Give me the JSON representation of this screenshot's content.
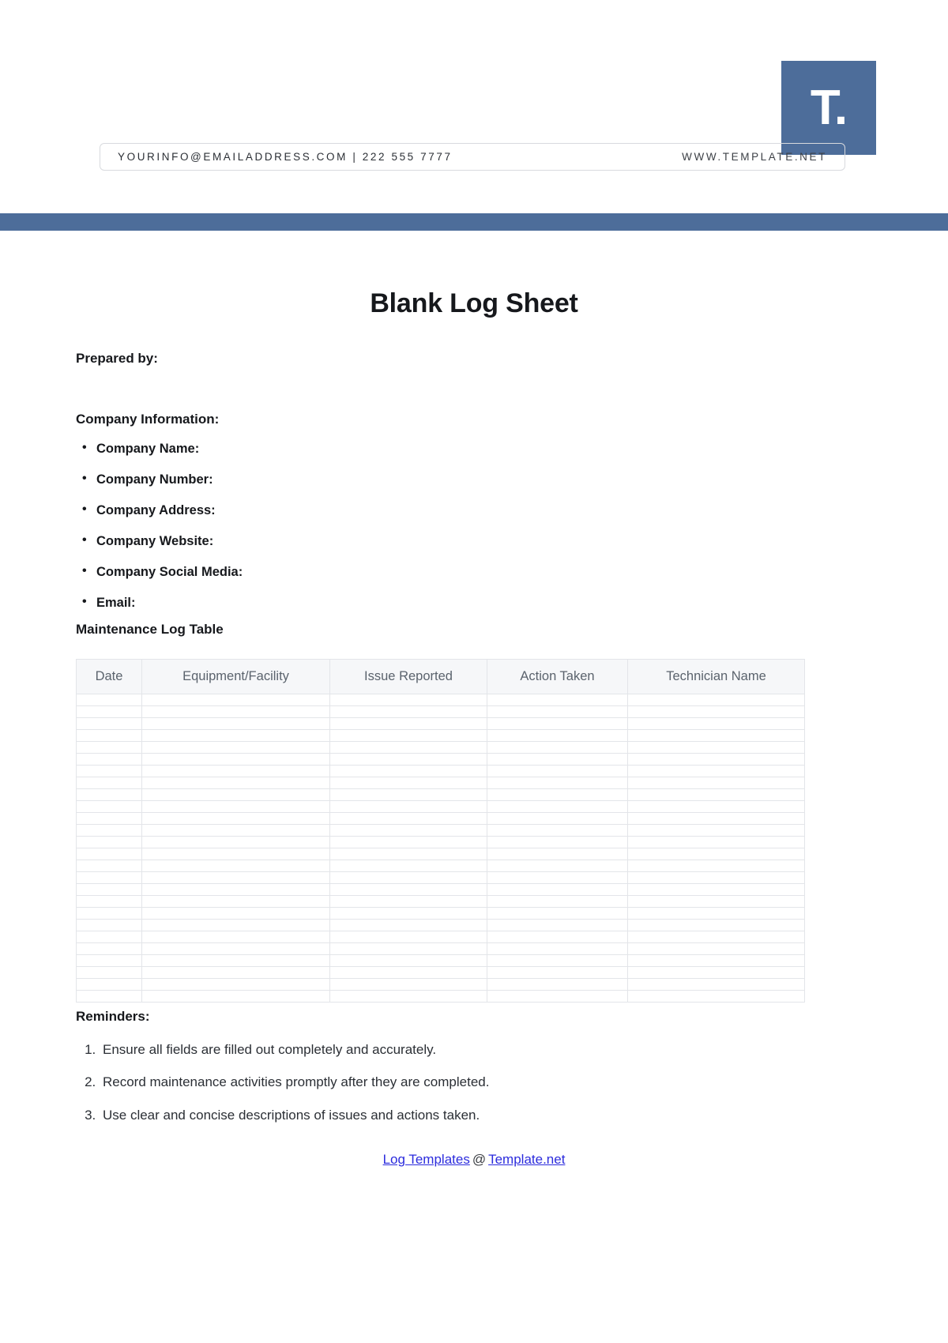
{
  "header": {
    "logo_text": "T.",
    "logo_color": "#4d6d9a",
    "contact_email_phone": "YOURINFO@EMAILADDRESS.COM | 222 555 7777",
    "website": "WWW.TEMPLATE.NET",
    "rule_color": "#4d6d9a"
  },
  "document": {
    "title": "Blank Log Sheet",
    "prepared_by_label": "Prepared by:",
    "company_info_label": "Company Information:",
    "company_fields": [
      "Company Name:",
      "Company Number:",
      "Company Address:",
      "Company Website:",
      "Company Social Media:",
      "Email:"
    ],
    "table_heading": "Maintenance Log Table",
    "table": {
      "columns": [
        "Date",
        "Equipment/Facility",
        "Issue Reported",
        "Action Taken",
        "Technician Name"
      ],
      "row_count": 26,
      "rows": []
    },
    "reminders_label": "Reminders:",
    "reminders": [
      "Ensure all fields are filled out completely and accurately.",
      "Record maintenance activities promptly after they are completed.",
      "Use clear and concise descriptions of issues and actions taken."
    ]
  },
  "footer": {
    "link_primary": "Log Templates",
    "separator": "@",
    "link_secondary": "Template.net",
    "link_color": "#2b2bdd"
  }
}
